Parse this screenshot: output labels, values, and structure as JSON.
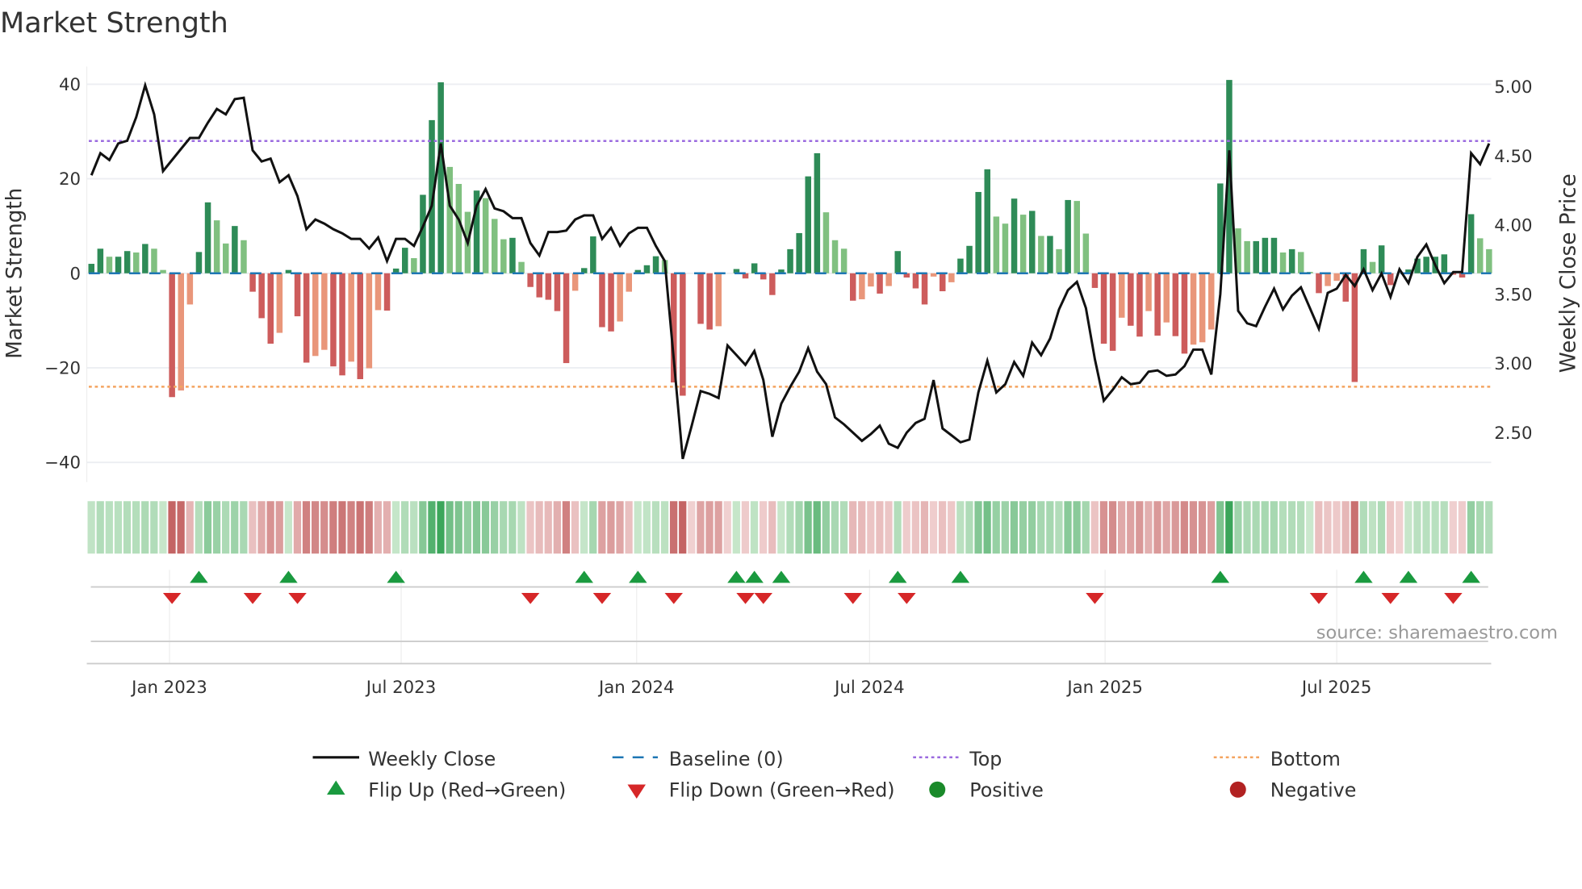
{
  "title": "Market Strength",
  "source": "source: sharemaestro.com",
  "colors": {
    "bar_pos_strong": "#2e8b57",
    "bar_pos_weak": "#80c080",
    "bar_neg_strong": "#cd5c5c",
    "bar_neg_weak": "#e9967a",
    "price_line": "#111111",
    "baseline": "#1f77b4",
    "top": "#9b6bdf",
    "bottom": "#f4a460",
    "flip_up": "#1a9a3f",
    "flip_down": "#d62728",
    "positive": "#1a8a2a",
    "negative": "#b22222"
  },
  "legend": {
    "weekly_close": "Weekly Close",
    "baseline": "Baseline (0)",
    "top": "Top",
    "bottom": "Bottom",
    "flip_up": "Flip Up (Red→Green)",
    "flip_down": "Flip Down (Green→Red)",
    "positive": "Positive",
    "negative": "Negative"
  },
  "chart_data": {
    "type": "bar+line",
    "title": "Market Strength",
    "ylabel": "Market Strength",
    "y2label": "Weekly Close Price",
    "frequency": "weekly",
    "start_date": "2022-11-01",
    "ylim": [
      -44,
      44
    ],
    "y2lim": [
      2.25,
      5.1
    ],
    "yticks": [
      "40",
      "20",
      "0",
      "−20",
      "−40"
    ],
    "ytick_values": [
      40,
      20,
      0,
      -20,
      -40
    ],
    "y2ticks": [
      "5.00",
      "4.50",
      "4.00",
      "3.50",
      "3.00",
      "2.50"
    ],
    "y2tick_values": [
      5.0,
      4.5,
      4.0,
      3.5,
      3.0,
      2.5
    ],
    "xticks": [
      "Jan 2023",
      "Jul 2023",
      "Jan 2024",
      "Jul 2024",
      "Jan 2025",
      "Jul 2025"
    ],
    "xtick_dates": [
      "2023-01-01",
      "2023-07-01",
      "2024-01-01",
      "2024-07-01",
      "2025-01-01",
      "2025-07-01"
    ],
    "top_threshold": 28,
    "bottom_threshold": -24,
    "baseline": 0,
    "legend_position": "bottom",
    "strength": [
      2.0,
      5.2,
      3.5,
      3.5,
      4.7,
      4.4,
      6.2,
      5.2,
      0.7,
      -26.2,
      -24.8,
      -6.6,
      4.5,
      15.0,
      11.2,
      6.3,
      10.0,
      7.0,
      -3.9,
      -9.5,
      -14.9,
      -12.6,
      0.7,
      -9.1,
      -18.9,
      -17.5,
      -16.2,
      -19.7,
      -21.6,
      -18.7,
      -22.4,
      -20.1,
      -7.8,
      -7.9,
      1.0,
      5.4,
      3.2,
      16.6,
      32.4,
      40.4,
      22.5,
      18.9,
      13.0,
      17.5,
      15.9,
      11.5,
      7.2,
      7.5,
      2.4,
      -2.9,
      -5.1,
      -5.6,
      -8.0,
      -19.0,
      -3.7,
      1.1,
      7.8,
      -11.4,
      -12.3,
      -10.2,
      -3.9,
      0.7,
      1.7,
      3.6,
      2.8,
      -23.1,
      -25.9,
      0,
      -10.7,
      -11.9,
      -11.2,
      0,
      0.9,
      -1.1,
      2.1,
      -1.3,
      -4.6,
      0.8,
      5.1,
      8.5,
      20.5,
      25.4,
      12.9,
      7.0,
      5.2,
      -5.8,
      -5.5,
      -2.8,
      -4.3,
      -2.7,
      4.7,
      -0.9,
      -3.2,
      -6.6,
      -0.7,
      -3.8,
      -1.9,
      3.1,
      5.8,
      17.2,
      22.0,
      12.0,
      10.5,
      15.8,
      12.4,
      13.2,
      7.9,
      7.9,
      5.1,
      15.5,
      15.3,
      8.4,
      -3.1,
      -14.9,
      -16.4,
      -9.4,
      -11.1,
      -13.4,
      -8.0,
      -13.2,
      -10.4,
      -13.3,
      -17.0,
      -15.1,
      -14.6,
      -11.9,
      19.0,
      40.9,
      9.5,
      6.8,
      6.8,
      7.5,
      7.5,
      4.4,
      5.1,
      4.5,
      0.3,
      -4.2,
      -2.7,
      -1.6,
      -6.0,
      -23.0,
      5.1,
      2.4,
      5.9,
      -2.5,
      0,
      0.8,
      3.1,
      3.5,
      3.5,
      4.0,
      -0.3,
      -0.9,
      12.5,
      7.4,
      5.1
    ],
    "weekly_close": [
      4.36,
      4.52,
      4.47,
      4.59,
      4.61,
      4.78,
      5.01,
      4.8,
      4.39,
      4.47,
      4.55,
      4.63,
      4.63,
      4.74,
      4.84,
      4.8,
      4.91,
      4.92,
      4.54,
      4.46,
      4.48,
      4.31,
      4.36,
      4.21,
      3.97,
      4.04,
      4.01,
      3.97,
      3.94,
      3.9,
      3.9,
      3.83,
      3.91,
      3.74,
      3.9,
      3.9,
      3.85,
      3.99,
      4.14,
      4.59,
      4.14,
      4.04,
      3.87,
      4.14,
      4.26,
      4.12,
      4.1,
      4.05,
      4.05,
      3.87,
      3.78,
      3.95,
      3.95,
      3.96,
      4.04,
      4.07,
      4.07,
      3.9,
      3.98,
      3.85,
      3.94,
      3.98,
      3.98,
      3.85,
      3.74,
      3.03,
      2.31,
      2.55,
      2.8,
      2.78,
      2.75,
      3.13,
      3.06,
      2.99,
      3.09,
      2.88,
      2.47,
      2.71,
      2.83,
      2.94,
      3.11,
      2.94,
      2.85,
      2.61,
      2.56,
      2.5,
      2.44,
      2.49,
      2.55,
      2.42,
      2.39,
      2.5,
      2.57,
      2.6,
      2.88,
      2.53,
      2.48,
      2.43,
      2.45,
      2.79,
      3.02,
      2.79,
      2.85,
      3.01,
      2.91,
      3.15,
      3.06,
      3.18,
      3.39,
      3.53,
      3.59,
      3.4,
      3.03,
      2.73,
      2.81,
      2.9,
      2.85,
      2.86,
      2.94,
      2.95,
      2.91,
      2.92,
      2.98,
      3.1,
      3.1,
      2.92,
      3.5,
      4.54,
      3.38,
      3.29,
      3.27,
      3.41,
      3.54,
      3.39,
      3.49,
      3.55,
      3.4,
      3.25,
      3.51,
      3.54,
      3.64,
      3.56,
      3.68,
      3.53,
      3.65,
      3.48,
      3.68,
      3.58,
      3.77,
      3.86,
      3.71,
      3.58,
      3.66,
      3.66,
      4.52,
      4.44,
      4.59
    ],
    "flip_up_weeks": [
      12,
      22,
      34,
      55,
      61,
      72,
      74,
      77,
      90,
      97,
      126,
      142,
      147,
      154
    ],
    "flip_down_weeks": [
      9,
      18,
      23,
      49,
      57,
      65,
      73,
      75,
      85,
      91,
      112,
      137,
      145,
      152
    ]
  }
}
